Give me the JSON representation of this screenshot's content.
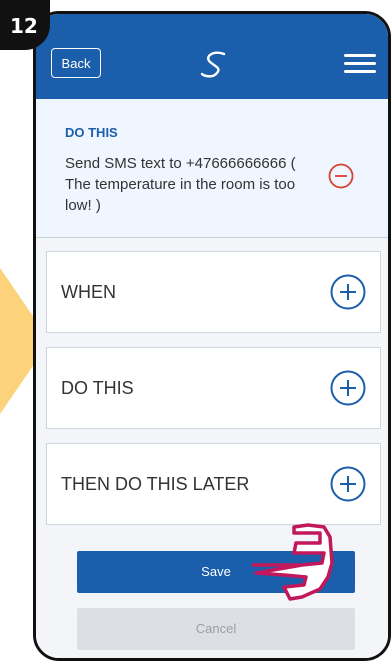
{
  "step": {
    "number": "12"
  },
  "header": {
    "back_label": "Back",
    "logo": "s-logo",
    "menu": "hamburger-icon"
  },
  "action_card": {
    "title": "DO THIS",
    "description": "Send SMS text to +47666666666 ( The temperature in the room is too low! )",
    "remove_icon": "minus-circle-icon"
  },
  "sections": [
    {
      "label": "WHEN",
      "add_icon": "plus-circle-icon"
    },
    {
      "label": "DO THIS",
      "add_icon": "plus-circle-icon"
    },
    {
      "label": "THEN DO THIS LATER",
      "add_icon": "plus-circle-icon"
    }
  ],
  "buttons": {
    "save": "Save",
    "cancel": "Cancel"
  },
  "colors": {
    "primary": "#1b5eab",
    "danger": "#d9412f",
    "hint": "#fcd27a",
    "highlight": "#c2185b"
  }
}
